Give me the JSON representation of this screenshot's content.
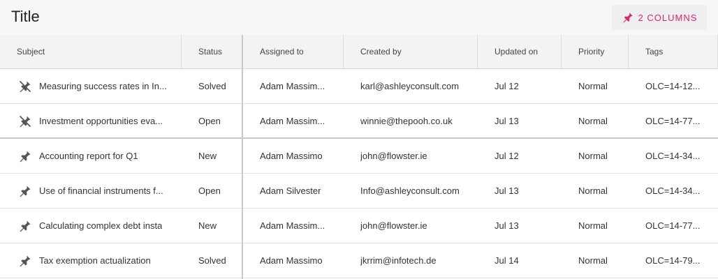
{
  "header": {
    "title": "Title",
    "pin_button_label": "2 COLUMNS",
    "accent_color": "#e0246e"
  },
  "columns": [
    "Subject",
    "Status",
    "Assigned to",
    "Created by",
    "Updated on",
    "Priority",
    "Tags"
  ],
  "rows": [
    {
      "pinned": true,
      "icon": "unpin-icon",
      "subject": "Measuring success rates in In...",
      "status": "Solved",
      "assigned": "Adam Massim...",
      "created": "karl@ashleyconsult.com",
      "updated": "Jul 12",
      "priority": "Normal",
      "tags": "OLC=14-12..."
    },
    {
      "pinned": true,
      "icon": "unpin-icon",
      "subject": "Investment opportunities eva...",
      "status": "Open",
      "assigned": "Adam Massim...",
      "created": "winnie@thepooh.co.uk",
      "updated": "Jul 13",
      "priority": "Normal",
      "tags": "OLC=14-77..."
    },
    {
      "pinned": false,
      "icon": "pin-icon",
      "subject": "Accounting report for Q1",
      "status": "New",
      "assigned": "Adam Massimo",
      "created": "john@flowster.ie",
      "updated": "Jul 12",
      "priority": "Normal",
      "tags": "OLC=14-34..."
    },
    {
      "pinned": false,
      "icon": "pin-icon",
      "subject": "Use of financial instruments f...",
      "status": "Open",
      "assigned": "Adam Silvester",
      "created": "Info@ashleyconsult.com",
      "updated": "Jul 13",
      "priority": "Normal",
      "tags": "OLC=14-34..."
    },
    {
      "pinned": false,
      "icon": "pin-icon",
      "subject": "Calculating complex debt insta",
      "status": "New",
      "assigned": "Adam Massim...",
      "created": "john@flowster.ie",
      "updated": "Jul 13",
      "priority": "Normal",
      "tags": "OLC=14-77..."
    },
    {
      "pinned": false,
      "icon": "pin-icon",
      "subject": "Tax exemption actualization",
      "status": "Solved",
      "assigned": "Adam Massimo",
      "created": "jkrrim@infotech.de",
      "updated": "Jul 14",
      "priority": "Normal",
      "tags": "OLC=14-79..."
    }
  ]
}
